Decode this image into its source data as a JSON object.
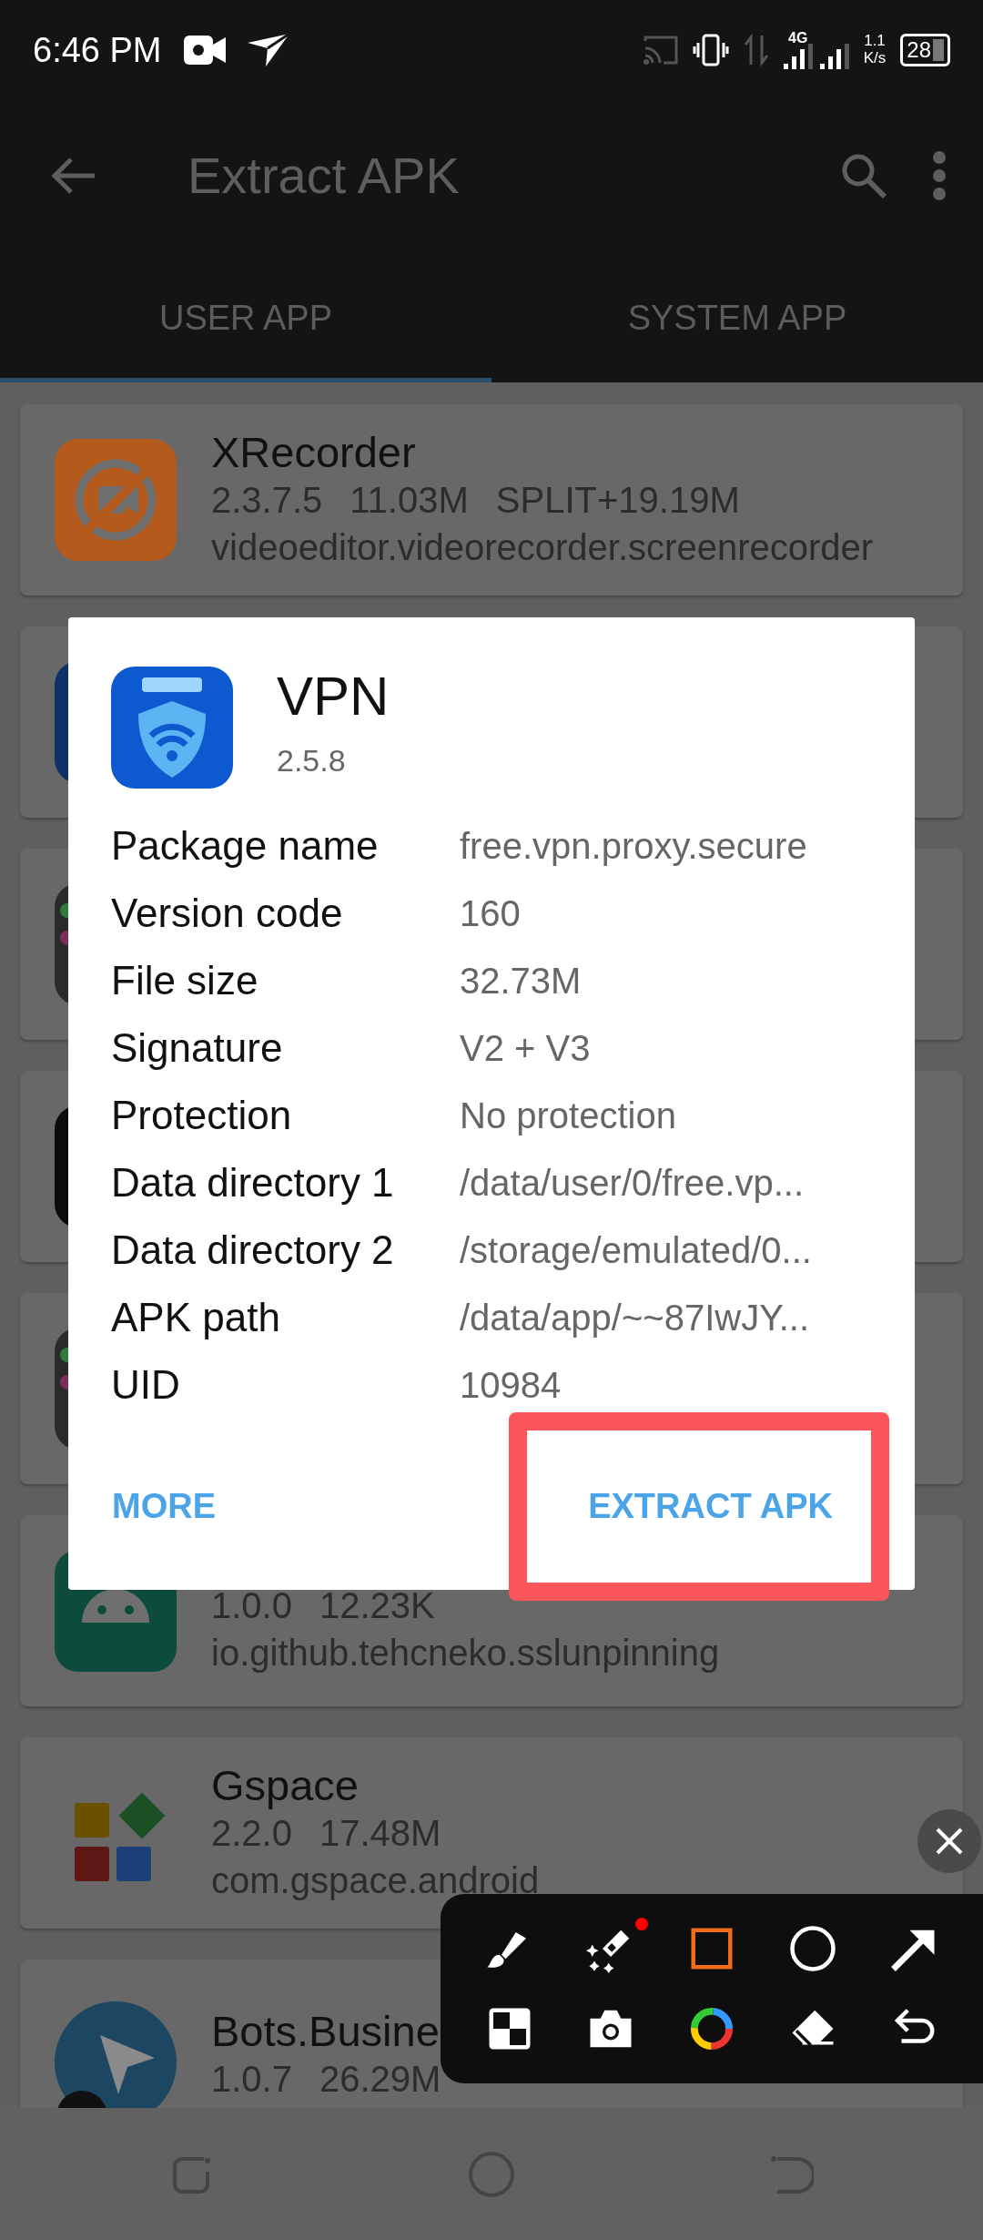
{
  "status_bar": {
    "time": "6:46 PM",
    "network": "4G",
    "speed": "1.1",
    "speed_unit": "K/s",
    "battery": "28"
  },
  "app_bar": {
    "title": "Extract APK"
  },
  "tabs": [
    {
      "label": "USER APP",
      "selected": true
    },
    {
      "label": "SYSTEM APP",
      "selected": false
    }
  ],
  "apps": [
    {
      "kind": "full",
      "name": "XRecorder",
      "version": "2.3.7.5",
      "size": "11.03M",
      "extra": "SPLIT+19.19M",
      "package": "videoeditor.videorecorder.screenrecorder"
    },
    {
      "kind": "covered"
    },
    {
      "kind": "covered"
    },
    {
      "kind": "covered"
    },
    {
      "kind": "covered"
    },
    {
      "kind": "full",
      "version": "1.0.0",
      "size": "12.23K",
      "package": "io.github.tehcneko.sslunpinning"
    },
    {
      "kind": "full",
      "name": "Gspace",
      "version": "2.2.0",
      "size": "17.48M",
      "package": "com.gspace.android"
    },
    {
      "kind": "full",
      "name": "Bots.Busine",
      "version": "1.0.7",
      "size": "26.29M"
    }
  ],
  "dialog": {
    "app_name": "VPN",
    "version": "2.5.8",
    "details": [
      {
        "label": "Package name",
        "value": "free.vpn.proxy.secure"
      },
      {
        "label": "Version code",
        "value": "160"
      },
      {
        "label": "File size",
        "value": "32.73M"
      },
      {
        "label": "Signature",
        "value": "V2 + V3"
      },
      {
        "label": "Protection",
        "value": "No protection"
      },
      {
        "label": "Data directory 1",
        "value": "/data/user/0/free.vp..."
      },
      {
        "label": "Data directory 2",
        "value": "/storage/emulated/0..."
      },
      {
        "label": "APK path",
        "value": "/data/app/~~87IwJY..."
      },
      {
        "label": "UID",
        "value": "10984"
      }
    ],
    "buttons": [
      {
        "label": "MORE",
        "highlighted": false
      },
      {
        "label": "EXTRACT APK",
        "highlighted": true
      }
    ]
  },
  "drawing_toolbar": {
    "tools": [
      {
        "kind": "brush",
        "selected": false
      },
      {
        "kind": "marker",
        "selected": false,
        "badge": true
      },
      {
        "kind": "rectangle",
        "selected": true
      },
      {
        "kind": "circle",
        "selected": false
      },
      {
        "kind": "arrow",
        "selected": false
      },
      {
        "kind": "mosaic",
        "selected": false
      },
      {
        "kind": "camera",
        "selected": false
      },
      {
        "kind": "color",
        "selected": false
      },
      {
        "kind": "eraser",
        "selected": false
      },
      {
        "kind": "undo",
        "selected": false
      }
    ]
  }
}
